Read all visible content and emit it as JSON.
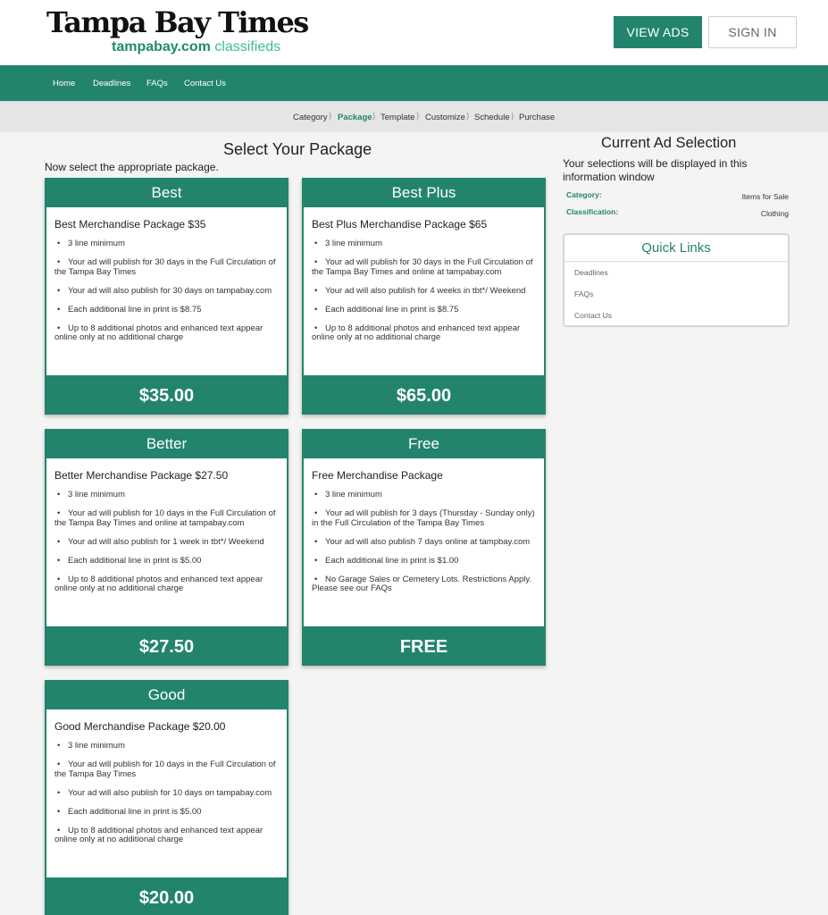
{
  "header": {
    "logo_text": "Tampa Bay Times",
    "logo_domain": "tampabay.com",
    "logo_classifieds": "classifieds",
    "view_ads_label": "VIEW ADS",
    "sign_in_label": "SIGN IN"
  },
  "nav": {
    "items": [
      {
        "label": "Home"
      },
      {
        "label": "Deadlines"
      },
      {
        "label": "FAQs"
      },
      {
        "label": "Contact Us"
      }
    ]
  },
  "breadcrumb": {
    "steps": [
      {
        "label": "Category",
        "active": false
      },
      {
        "label": "Package",
        "active": true
      },
      {
        "label": "Template",
        "active": false
      },
      {
        "label": "Customize",
        "active": false
      },
      {
        "label": "Schedule",
        "active": false
      },
      {
        "label": "Purchase",
        "active": false
      }
    ],
    "separator": "⟩"
  },
  "main": {
    "title": "Select Your Package",
    "subtitle": "Now select the appropriate package."
  },
  "packages": [
    {
      "name": "Best",
      "title": "Best Merchandise Package $35",
      "features": [
        "3 line minimum",
        "Your ad will publish for 30 days in the Full Circulation of the Tampa Bay Times",
        "Your ad will also publish for 30 days on tampabay.com",
        "Each additional line in print is $8.75",
        "Up to 8 additional photos and enhanced text appear online only at no additional charge"
      ],
      "price": "$35.00"
    },
    {
      "name": "Best Plus",
      "title": "Best Plus Merchandise Package $65",
      "features": [
        "3 line minimum",
        "Your ad will publish for 30 days in the Full Circulation of the Tampa Bay Times and online at tampabay.com",
        "Your ad will also publish for 4 weeks in tbt*/ Weekend",
        "Each additional line in print is $8.75",
        "Up to 8 additional photos and enhanced text appear online only at no additional charge"
      ],
      "price": "$65.00"
    },
    {
      "name": "Better",
      "title": "Better Merchandise Package $27.50",
      "features": [
        "3 line minimum",
        "Your ad will publish for 10 days in the Full Circulation of the Tampa Bay Times and online at tampabay.com",
        "Your ad will also publish for 1 week in tbt*/ Weekend",
        "Each additional line in print is $5.00",
        "Up to 8 additional photos and enhanced text appear online only at no additional charge"
      ],
      "price": "$27.50"
    },
    {
      "name": "Free",
      "title": "Free Merchandise Package",
      "features": [
        "3 line minimum",
        "Your ad will publish for 3 days (Thursday - Sunday only) in the Full Circulation of the Tampa Bay Times",
        "Your ad will also publish 7 days online at tampbay.com",
        "Each additional line in print is $1.00",
        "No Garage Sales or Cemetery Lots. Restrictions Apply. Please see our FAQs"
      ],
      "price": "FREE"
    },
    {
      "name": "Good",
      "title": "Good Merchandise Package $20.00",
      "features": [
        "3 line minimum",
        "Your ad will publish for 10 days in the Full Circulation of the Tampa Bay Times",
        "Your ad will also publish for 10 days on tampabay.com",
        "Each additional line in print is $5.00",
        "Up to 8 additional photos and enhanced text appear online only at no additional charge"
      ],
      "price": "$20.00"
    }
  ],
  "sidebar": {
    "title": "Current Ad Selection",
    "description": "Your selections will be displayed in this information window",
    "category_label": "Category:",
    "category_value": "Items for Sale",
    "classification_label": "Classification:",
    "classification_value": "Clothing",
    "quick_links": {
      "title": "Quick Links",
      "links": [
        {
          "label": "Deadlines"
        },
        {
          "label": "FAQs"
        },
        {
          "label": "Contact Us"
        }
      ]
    }
  },
  "colors": {
    "brand_green": "#23846e",
    "light_green": "#3cbf8d",
    "page_bg": "#f4f4f4"
  }
}
